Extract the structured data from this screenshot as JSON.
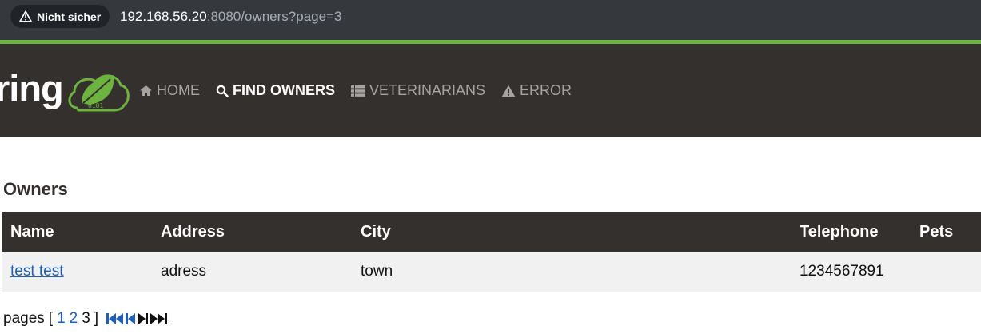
{
  "browser": {
    "security_label": "Nicht sicher",
    "url_host": "192.168.56.20",
    "url_rest": ":8080/owners?page=3"
  },
  "brand": {
    "text": "ring"
  },
  "nav": {
    "items": [
      {
        "label": "Home",
        "icon": "home-icon"
      },
      {
        "label": "Find owners",
        "icon": "search-icon",
        "active": true
      },
      {
        "label": "Veterinarians",
        "icon": "list-icon"
      },
      {
        "label": "Error",
        "icon": "warning-icon"
      }
    ]
  },
  "page": {
    "title": "Owners"
  },
  "table": {
    "columns": [
      "Name",
      "Address",
      "City",
      "Telephone",
      "Pets"
    ],
    "rows": [
      {
        "name": "test test",
        "address": "adress",
        "city": "town",
        "telephone": "1234567891",
        "pets": ""
      }
    ]
  },
  "pagination": {
    "label": "pages",
    "open_bracket": "[",
    "close_bracket": "]",
    "pages": [
      "1",
      "2"
    ],
    "current": "3"
  },
  "colors": {
    "nav_bg": "#34302d",
    "accent": "#6db33f",
    "link": "#1f5fb8"
  }
}
